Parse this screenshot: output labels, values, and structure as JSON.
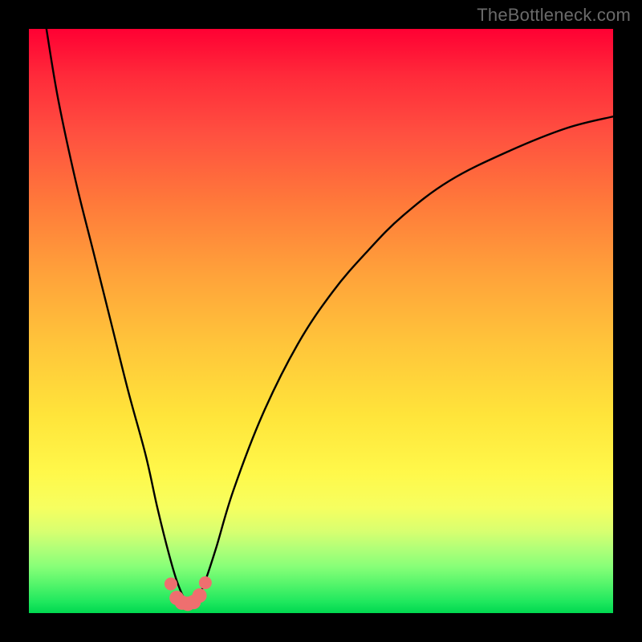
{
  "attribution": "TheBottleneck.com",
  "chart_data": {
    "type": "line",
    "title": "",
    "xlabel": "",
    "ylabel": "",
    "xlim": [
      0,
      100
    ],
    "ylim": [
      0,
      100
    ],
    "series": [
      {
        "name": "bottleneck-curve",
        "x": [
          3,
          5,
          8,
          11,
          14,
          17,
          20,
          22,
          24,
          25.5,
          27,
          28.5,
          30,
          32,
          35,
          40,
          46,
          52,
          58,
          64,
          72,
          82,
          92,
          100
        ],
        "y": [
          100,
          88,
          74,
          62,
          50,
          38,
          27,
          18,
          10,
          5,
          2,
          2,
          5,
          11,
          21,
          34,
          46,
          55,
          62,
          68,
          74,
          79,
          83,
          85
        ]
      }
    ],
    "markers": {
      "name": "highlight-dots",
      "color": "#ee6f6f",
      "x": [
        24.3,
        25.3,
        26.2,
        27.2,
        28.2,
        29.2,
        30.2
      ],
      "y": [
        5.0,
        2.6,
        1.8,
        1.6,
        1.9,
        3.0,
        5.2
      ]
    },
    "gradient_stops": [
      {
        "pos": 0,
        "color": "#ff0033"
      },
      {
        "pos": 50,
        "color": "#ffc53a"
      },
      {
        "pos": 80,
        "color": "#fff84a"
      },
      {
        "pos": 100,
        "color": "#00d850"
      }
    ]
  }
}
